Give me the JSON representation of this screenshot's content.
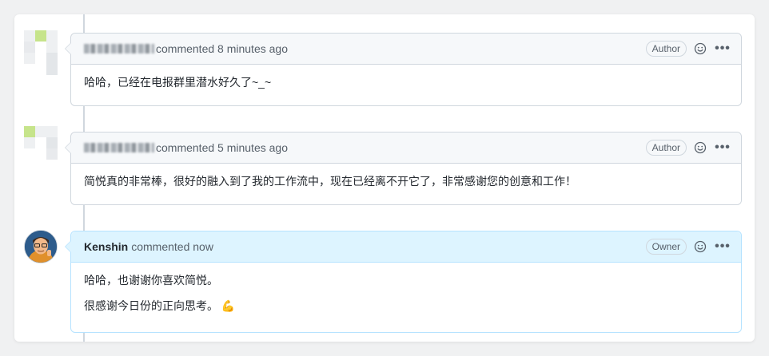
{
  "comments": [
    {
      "author": "",
      "author_blurred": true,
      "time_text": "commented 8 minutes ago",
      "role": "Author",
      "body": [
        "哈哈，已经在电报群里潜水好久了~_~"
      ],
      "avatar": "identicon"
    },
    {
      "author": "",
      "author_blurred": true,
      "time_text": "commented 5 minutes ago",
      "role": "Author",
      "body": [
        "简悦真的非常棒，很好的融入到了我的工作流中，现在已经离不开它了，非常感谢您的创意和工作！"
      ],
      "avatar": "identicon"
    },
    {
      "author": "Kenshin",
      "author_blurred": false,
      "time_text": "commented now",
      "role": "Owner",
      "body": [
        "哈哈，也谢谢你喜欢简悦。",
        "很感谢今日份的正向思考。 💪"
      ],
      "avatar": "photo"
    }
  ],
  "icons": {
    "reaction": "smiley-icon",
    "menu": "kebab-horizontal-icon"
  },
  "colors": {
    "owner_header_bg": "#ddf4ff",
    "header_bg": "#f6f8fa",
    "border": "#d0d7de",
    "identicon_green": "#c6e48b"
  }
}
